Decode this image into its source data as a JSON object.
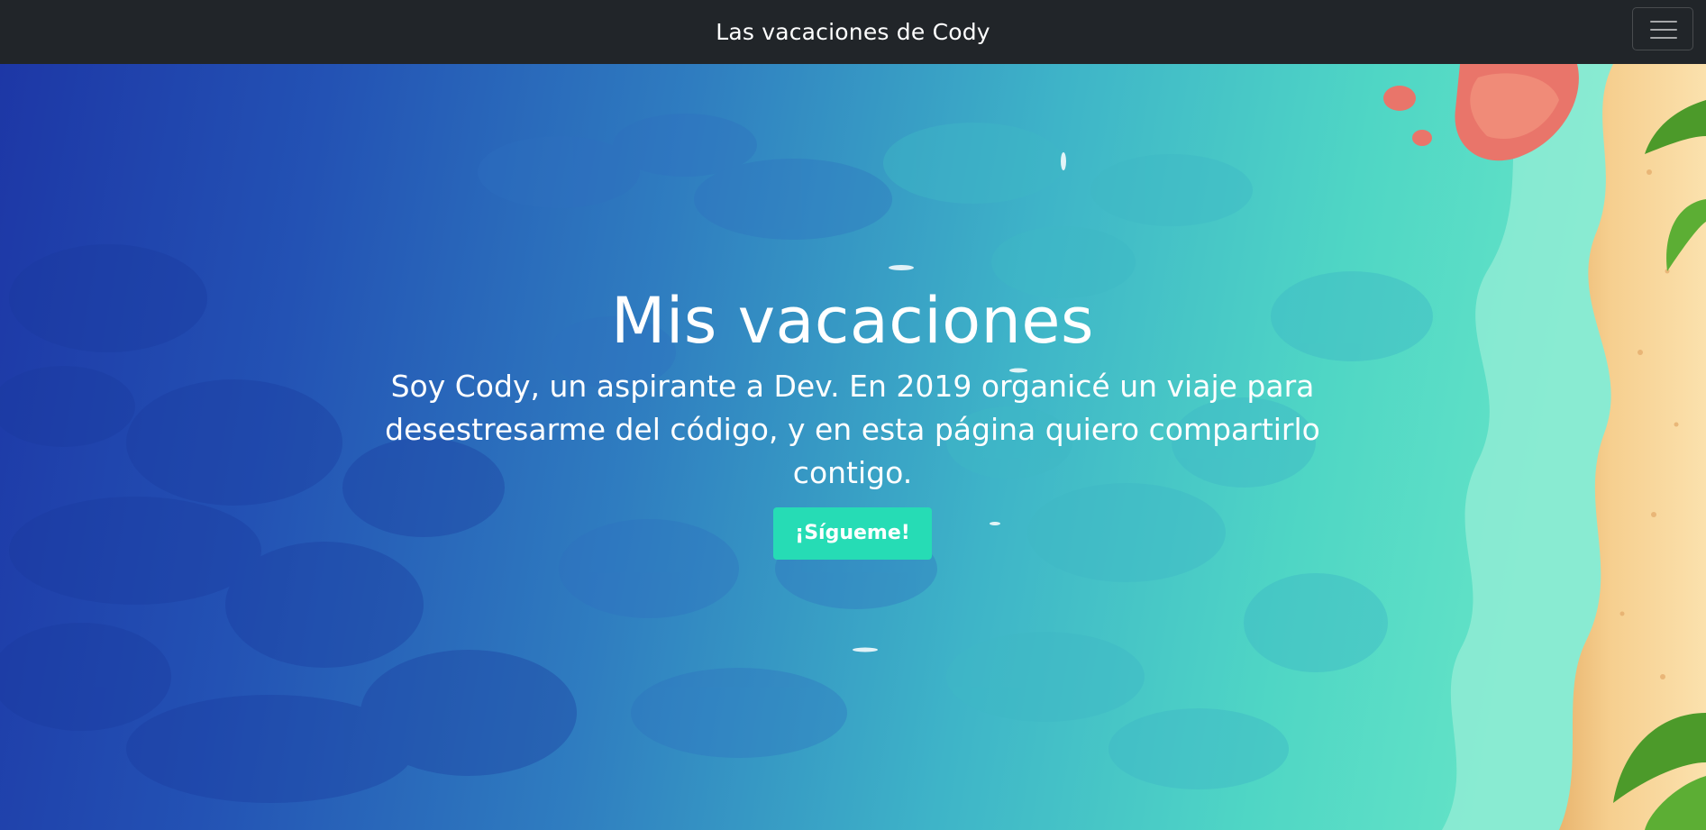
{
  "navbar": {
    "brand": "Las vacaciones de Cody",
    "menu_icon": "hamburger-menu-icon"
  },
  "hero": {
    "title": "Mis vacaciones",
    "subtitle": "Soy Cody, un aspirante a Dev. En 2019 organicé un viaje para desestresarme del código, y en esta página quiero compartirlo contigo.",
    "cta_label": "¡Sígueme!"
  },
  "colors": {
    "navbar_bg": "#212529",
    "ocean_deep": "#1d37a6",
    "ocean_shallow": "#63e3c6",
    "button_bg": "#26dcb5",
    "sand": "#f5c98a"
  }
}
